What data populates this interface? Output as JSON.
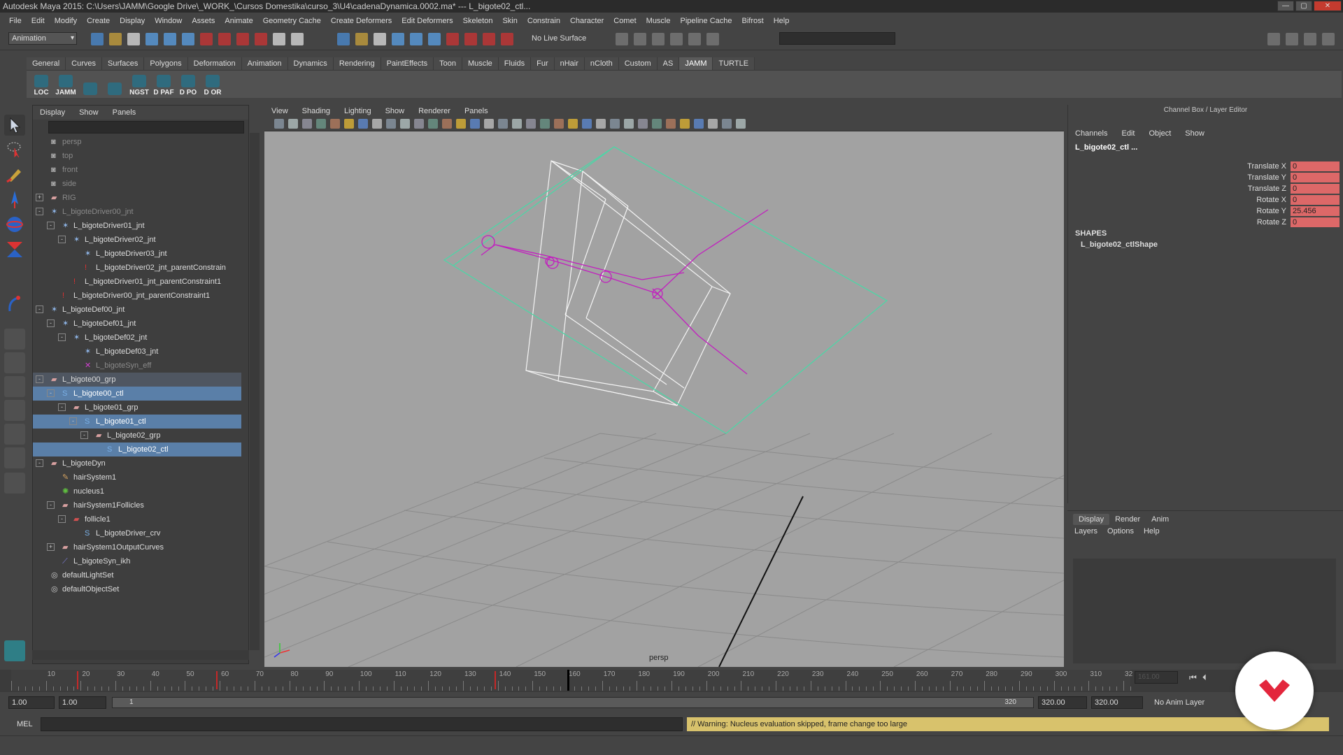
{
  "window": {
    "title": "Autodesk Maya 2015: C:\\Users\\JAMM\\Google Drive\\_WORK_\\Cursos Domestika\\curso_3\\U4\\cadenaDynamica.0002.ma*   ---   L_bigote02_ctl..."
  },
  "menus": [
    "File",
    "Edit",
    "Modify",
    "Create",
    "Display",
    "Window",
    "Assets",
    "Animate",
    "Geometry Cache",
    "Create Deformers",
    "Edit Deformers",
    "Skeleton",
    "Skin",
    "Constrain",
    "Character",
    "Comet",
    "Muscle",
    "Pipeline Cache",
    "Bifrost",
    "Help"
  ],
  "status_line": {
    "mode": "Animation",
    "live_surface": "No Live Surface"
  },
  "shelf": {
    "tabs": [
      "General",
      "Curves",
      "Surfaces",
      "Polygons",
      "Deformation",
      "Animation",
      "Dynamics",
      "Rendering",
      "PaintEffects",
      "Toon",
      "Muscle",
      "Fluids",
      "Fur",
      "nHair",
      "nCloth",
      "Custom",
      "AS",
      "JAMM",
      "TURTLE"
    ],
    "active_tab": "JAMM",
    "buttons": [
      "LOC",
      "JAMM",
      "",
      "",
      "NGST",
      "D PAF",
      "D PO",
      "D OR"
    ]
  },
  "outliner": {
    "menu": [
      "Display",
      "Show",
      "Panels"
    ],
    "rows": [
      {
        "label": "persp",
        "depth": 1,
        "icon": "camera-icon",
        "dim": true
      },
      {
        "label": "top",
        "depth": 1,
        "icon": "camera-icon",
        "dim": true
      },
      {
        "label": "front",
        "depth": 1,
        "icon": "camera-icon",
        "dim": true
      },
      {
        "label": "side",
        "depth": 1,
        "icon": "camera-icon",
        "dim": true
      },
      {
        "label": "RIG",
        "depth": 1,
        "icon": "group-icon",
        "dim": true,
        "expander": "+"
      },
      {
        "label": "L_bigoteDriver00_jnt",
        "depth": 1,
        "icon": "joint-icon",
        "dim": true,
        "expander": "-"
      },
      {
        "label": "L_bigoteDriver01_jnt",
        "depth": 2,
        "icon": "joint-icon",
        "expander": "-"
      },
      {
        "label": "L_bigoteDriver02_jnt",
        "depth": 3,
        "icon": "joint-icon",
        "expander": "-"
      },
      {
        "label": "L_bigoteDriver03_jnt",
        "depth": 4,
        "icon": "joint-icon"
      },
      {
        "label": "L_bigoteDriver02_jnt_parentConstrain",
        "depth": 4,
        "icon": "constraint-icon"
      },
      {
        "label": "L_bigoteDriver01_jnt_parentConstraint1",
        "depth": 3,
        "icon": "constraint-icon"
      },
      {
        "label": "L_bigoteDriver00_jnt_parentConstraint1",
        "depth": 2,
        "icon": "constraint-icon"
      },
      {
        "label": "L_bigoteDef00_jnt",
        "depth": 1,
        "icon": "joint-icon",
        "expander": "-"
      },
      {
        "label": "L_bigoteDef01_jnt",
        "depth": 2,
        "icon": "joint-icon",
        "expander": "-"
      },
      {
        "label": "L_bigoteDef02_jnt",
        "depth": 3,
        "icon": "joint-icon",
        "expander": "-"
      },
      {
        "label": "L_bigoteDef03_jnt",
        "depth": 4,
        "icon": "joint-icon"
      },
      {
        "label": "L_bigoteSyn_eff",
        "depth": 4,
        "icon": "effector-icon",
        "dim": true
      },
      {
        "label": "L_bigote00_grp",
        "depth": 1,
        "icon": "group-icon",
        "expander": "-",
        "sel": "light"
      },
      {
        "label": "L_bigote00_ctl",
        "depth": 2,
        "icon": "curve-icon",
        "expander": "-",
        "sel": true
      },
      {
        "label": "L_bigote01_grp",
        "depth": 3,
        "icon": "group-icon",
        "expander": "-"
      },
      {
        "label": "L_bigote01_ctl",
        "depth": 4,
        "icon": "curve-icon",
        "expander": "-",
        "sel": true
      },
      {
        "label": "L_bigote02_grp",
        "depth": 5,
        "icon": "group-icon",
        "expander": "-"
      },
      {
        "label": "L_bigote02_ctl",
        "depth": 6,
        "icon": "curve-icon",
        "sel": true
      },
      {
        "label": "L_bigoteDyn",
        "depth": 1,
        "icon": "group-icon",
        "expander": "-"
      },
      {
        "label": "hairSystem1",
        "depth": 2,
        "icon": "hair-icon"
      },
      {
        "label": "nucleus1",
        "depth": 2,
        "icon": "nucleus-icon"
      },
      {
        "label": "hairSystem1Follicles",
        "depth": 2,
        "icon": "group-icon",
        "expander": "-"
      },
      {
        "label": "follicle1",
        "depth": 3,
        "icon": "follicle-icon",
        "expander": "-"
      },
      {
        "label": "L_bigoteDriver_crv",
        "depth": 4,
        "icon": "curve-icon"
      },
      {
        "label": "hairSystem1OutputCurves",
        "depth": 2,
        "icon": "group-icon",
        "expander": "+"
      },
      {
        "label": "L_bigoteSyn_ikh",
        "depth": 2,
        "icon": "ikhandle-icon"
      },
      {
        "label": "defaultLightSet",
        "depth": 1,
        "icon": "set-icon"
      },
      {
        "label": "defaultObjectSet",
        "depth": 1,
        "icon": "set-icon"
      }
    ]
  },
  "viewport": {
    "menu": [
      "View",
      "Shading",
      "Lighting",
      "Show",
      "Renderer",
      "Panels"
    ],
    "camera_label": "persp"
  },
  "channel_box": {
    "title": "Channel Box / Layer Editor",
    "menu": [
      "Channels",
      "Edit",
      "Object",
      "Show"
    ],
    "object": "L_bigote02_ctl ...",
    "attributes": [
      {
        "name": "Translate X",
        "value": "0"
      },
      {
        "name": "Translate Y",
        "value": "0"
      },
      {
        "name": "Translate Z",
        "value": "0"
      },
      {
        "name": "Rotate X",
        "value": "0"
      },
      {
        "name": "Rotate Y",
        "value": "25.456"
      },
      {
        "name": "Rotate Z",
        "value": "0"
      }
    ],
    "shapes_header": "SHAPES",
    "shape_name": "L_bigote02_ctlShape"
  },
  "layer_editor": {
    "tabs": [
      "Display",
      "Render",
      "Anim"
    ],
    "active_tab": "Display",
    "menu": [
      "Layers",
      "Options",
      "Help"
    ]
  },
  "time_slider": {
    "labels": [
      "10",
      "20",
      "30",
      "40",
      "50",
      "60",
      "70",
      "80",
      "90",
      "100",
      "110",
      "120",
      "130",
      "140",
      "150",
      "160",
      "170",
      "180",
      "190",
      "200",
      "210",
      "220",
      "230",
      "240",
      "250",
      "260",
      "270",
      "280",
      "290",
      "300",
      "310",
      "32"
    ],
    "current_frame": "160",
    "current_time_field": "161.00"
  },
  "range_slider": {
    "start": "1.00",
    "anim_start": "1.00",
    "range_start_label": "1",
    "range_end_label": "320",
    "anim_end": "320.00",
    "end": "320.00",
    "anim_layer": "No Anim Layer"
  },
  "command_line": {
    "label": "MEL",
    "warning": "// Warning: Nucleus evaluation skipped, frame change too large"
  }
}
